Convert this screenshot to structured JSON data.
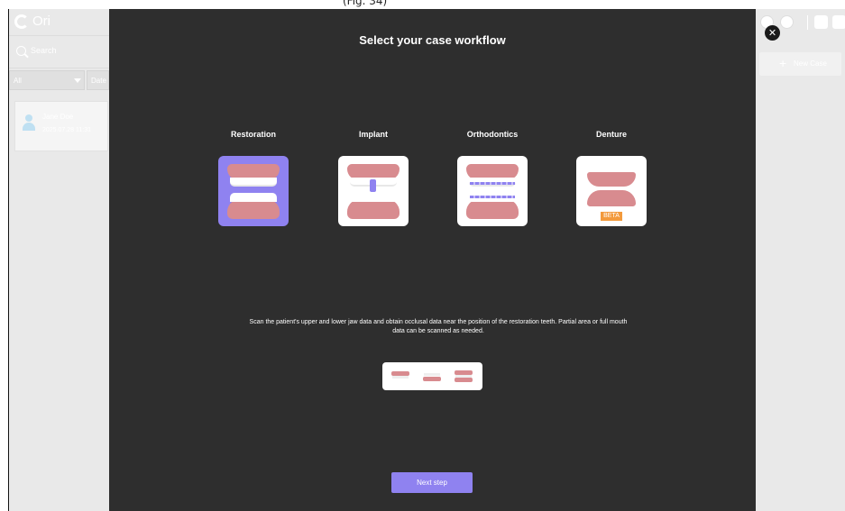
{
  "top_bar": {
    "text": "(Fig. 34)"
  },
  "app": {
    "name": "Ori"
  },
  "sidebar": {
    "search_placeholder": "Search",
    "filter_value": "All",
    "date_filter": "Date",
    "cases": [
      {
        "name": "Jane Doe",
        "date": "2025.07.28 11:31"
      }
    ]
  },
  "right_panel": {
    "new_case_label": "New Case",
    "new_case_icon": "plus-icon"
  },
  "dialog": {
    "title": "Select your case workflow",
    "workflows": [
      {
        "label": "Restoration",
        "selected": true
      },
      {
        "label": "Implant",
        "selected": false
      },
      {
        "label": "Orthodontics",
        "selected": false
      },
      {
        "label": "Denture",
        "selected": false,
        "badge": "BETA"
      }
    ],
    "description": "Scan the patient's upper and lower jaw data and obtain occlusal data near the position of the restoration teeth. Partial area or full mouth data can be scanned as needed.",
    "next_button": "Next step",
    "close_icon": "close-icon"
  },
  "colors": {
    "accent": "#8f82f0",
    "dialog_bg": "#2e2e2e",
    "gum": "#d88b8f",
    "beta": "#f39a3c"
  }
}
